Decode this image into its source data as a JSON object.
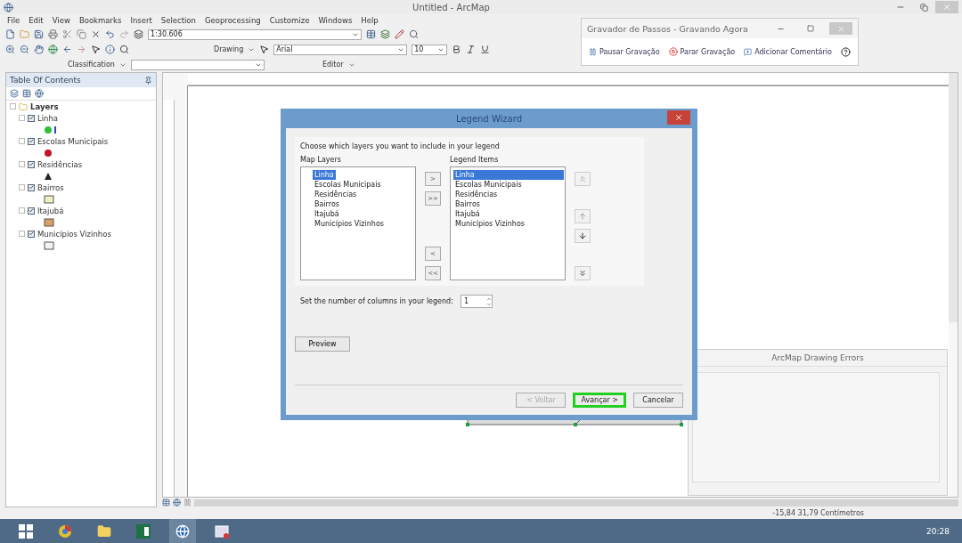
{
  "window": {
    "title": "Untitled - ArcMap"
  },
  "menu": [
    "File",
    "Edit",
    "View",
    "Bookmarks",
    "Insert",
    "Selection",
    "Geoprocessing",
    "Customize",
    "Windows",
    "Help"
  ],
  "toolbars": {
    "scale": "1:30.606",
    "drawing": "Drawing",
    "font": "Arial",
    "font_size": "10",
    "classification": "Classification",
    "editor": "Editor"
  },
  "recorder": {
    "title": "Gravador de Passos - Gravando Agora",
    "actions": [
      "Pausar Gravação",
      "Parar Gravação",
      "Adicionar Comentário"
    ]
  },
  "toc": {
    "title": "Table Of Contents",
    "root": {
      "label": "Layers",
      "expanded": true,
      "children": [
        {
          "label": "Linha",
          "checked": true,
          "kind": "point_line",
          "color": "#2fbf3a"
        },
        {
          "label": "Escolas Municipais",
          "checked": true,
          "kind": "point",
          "color": "#c0182a"
        },
        {
          "label": "Residências",
          "checked": true,
          "kind": "triangle",
          "color": "#222222"
        },
        {
          "label": "Bairros",
          "checked": true,
          "kind": "polygon",
          "color": "#f3efc4"
        },
        {
          "label": "Itajubá",
          "checked": true,
          "kind": "polygon",
          "color": "#d9a066"
        },
        {
          "label": "Municípios Vizinhos",
          "checked": true,
          "kind": "polygon",
          "color": "#f2f2f2"
        }
      ]
    }
  },
  "dialog": {
    "title": "Legend Wizard",
    "prompt": "Choose which layers you want to include in your legend",
    "map_layers": {
      "label": "Map Layers",
      "items": [
        {
          "label": "Linha",
          "selected": true
        },
        {
          "label": "Escolas Municipais",
          "selected": false
        },
        {
          "label": "Residências",
          "selected": false
        },
        {
          "label": "Bairros",
          "selected": false
        },
        {
          "label": "Itajubá",
          "selected": false
        },
        {
          "label": "Municípios Vizinhos",
          "selected": false
        }
      ]
    },
    "move_buttons": [
      ">",
      ">>",
      "<",
      "<<"
    ],
    "legend_items": {
      "label": "Legend Items",
      "items": [
        {
          "label": "Linha",
          "selected": true
        },
        {
          "label": "Escolas Municipais",
          "selected": false
        },
        {
          "label": "Residências",
          "selected": false
        },
        {
          "label": "Bairros",
          "selected": false
        },
        {
          "label": "Itajubá",
          "selected": false
        },
        {
          "label": "Municípios Vizinhos",
          "selected": false
        }
      ]
    },
    "columns": {
      "label": "Set the number of columns in your legend:",
      "value": "1"
    },
    "preview": "Preview",
    "buttons": [
      {
        "label": "< Voltar",
        "disabled": true,
        "highlighted": false
      },
      {
        "label": "Avançar >",
        "disabled": false,
        "highlighted": true
      },
      {
        "label": "Cancelar",
        "disabled": false,
        "highlighted": false
      }
    ]
  },
  "errors_panel": {
    "title": "ArcMap Drawing Errors"
  },
  "status_bar": {
    "coordinates": "-15,84  31,79 Centímetros"
  },
  "taskbar": {
    "clock": "20:28"
  }
}
